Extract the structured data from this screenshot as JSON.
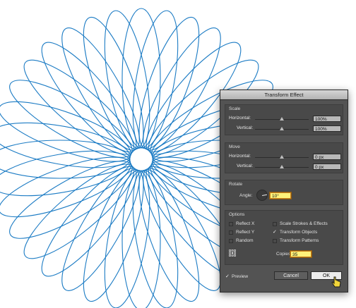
{
  "dialog": {
    "title": "Transform Effect",
    "scale": {
      "legend": "Scale",
      "horizontal_label": "Horizontal:",
      "horizontal_value": "100%",
      "vertical_label": "Vertical:",
      "vertical_value": "100%"
    },
    "move": {
      "legend": "Move",
      "horizontal_label": "Horizontal:",
      "horizontal_value": "0 px",
      "vertical_label": "Vertical:",
      "vertical_value": "0 px"
    },
    "rotate": {
      "legend": "Rotate",
      "angle_label": "Angle:",
      "angle_value": "10°"
    },
    "options": {
      "legend": "Options",
      "reflect_x": {
        "label": "Reflect X",
        "checked": false
      },
      "reflect_y": {
        "label": "Reflect Y",
        "checked": false
      },
      "random": {
        "label": "Random",
        "checked": false
      },
      "scale_strokes": {
        "label": "Scale Strokes & Effects",
        "checked": false
      },
      "transform_objects": {
        "label": "Transform Objects",
        "checked": true
      },
      "transform_patterns": {
        "label": "Transform Patterns",
        "checked": false
      },
      "copies_label": "Copies",
      "copies_value": "35",
      "reference_point_icon": "reference-point-grid-icon"
    },
    "preview": {
      "label": "Preview",
      "checked": true
    },
    "cancel_label": "Cancel",
    "ok_label": "OK"
  },
  "artwork": {
    "stroke_color": "#1b7bc4",
    "petal_count": 36,
    "rotation_step_deg": 10
  },
  "colors": {
    "dialog_bg": "#535353",
    "active_field": "#fff27a",
    "artwork_stroke": "#1b7bc4"
  }
}
